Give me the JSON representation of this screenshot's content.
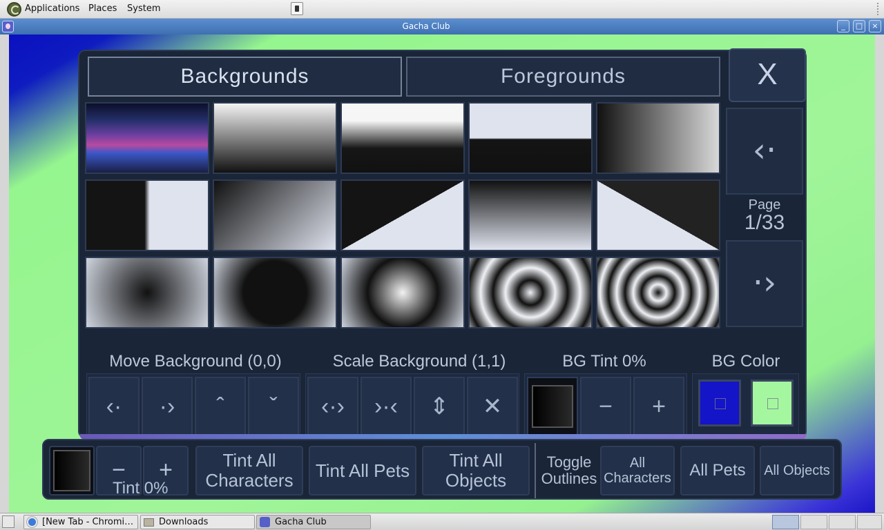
{
  "top_panel": {
    "menus": [
      "Applications",
      "Places",
      "System"
    ]
  },
  "window": {
    "title": "Gacha Club"
  },
  "tabs": {
    "backgrounds": "Backgrounds",
    "foregrounds": "Foregrounds"
  },
  "close_label": "X",
  "pager": {
    "page_label": "Page",
    "page_value": "1/33"
  },
  "sections": {
    "move": "Move Background (0,0)",
    "scale": "Scale Background (1,1)",
    "tint": "BG Tint 0%",
    "color": "BG Color"
  },
  "bg_colors": {
    "primary": "#1414c8",
    "secondary": "#a5f79f"
  },
  "bottom": {
    "tint_label": "Tint 0%",
    "tint_all_characters": "Tint All Characters",
    "tint_all_pets": "Tint All Pets",
    "tint_all_objects": "Tint All Objects",
    "toggle_outlines": "Toggle Outlines",
    "all_characters": "All Characters",
    "all_pets": "All Pets",
    "all_objects": "All Objects"
  },
  "taskbar": {
    "tasks": [
      "[New Tab - Chromi…",
      "Downloads",
      "Gacha Club"
    ]
  }
}
